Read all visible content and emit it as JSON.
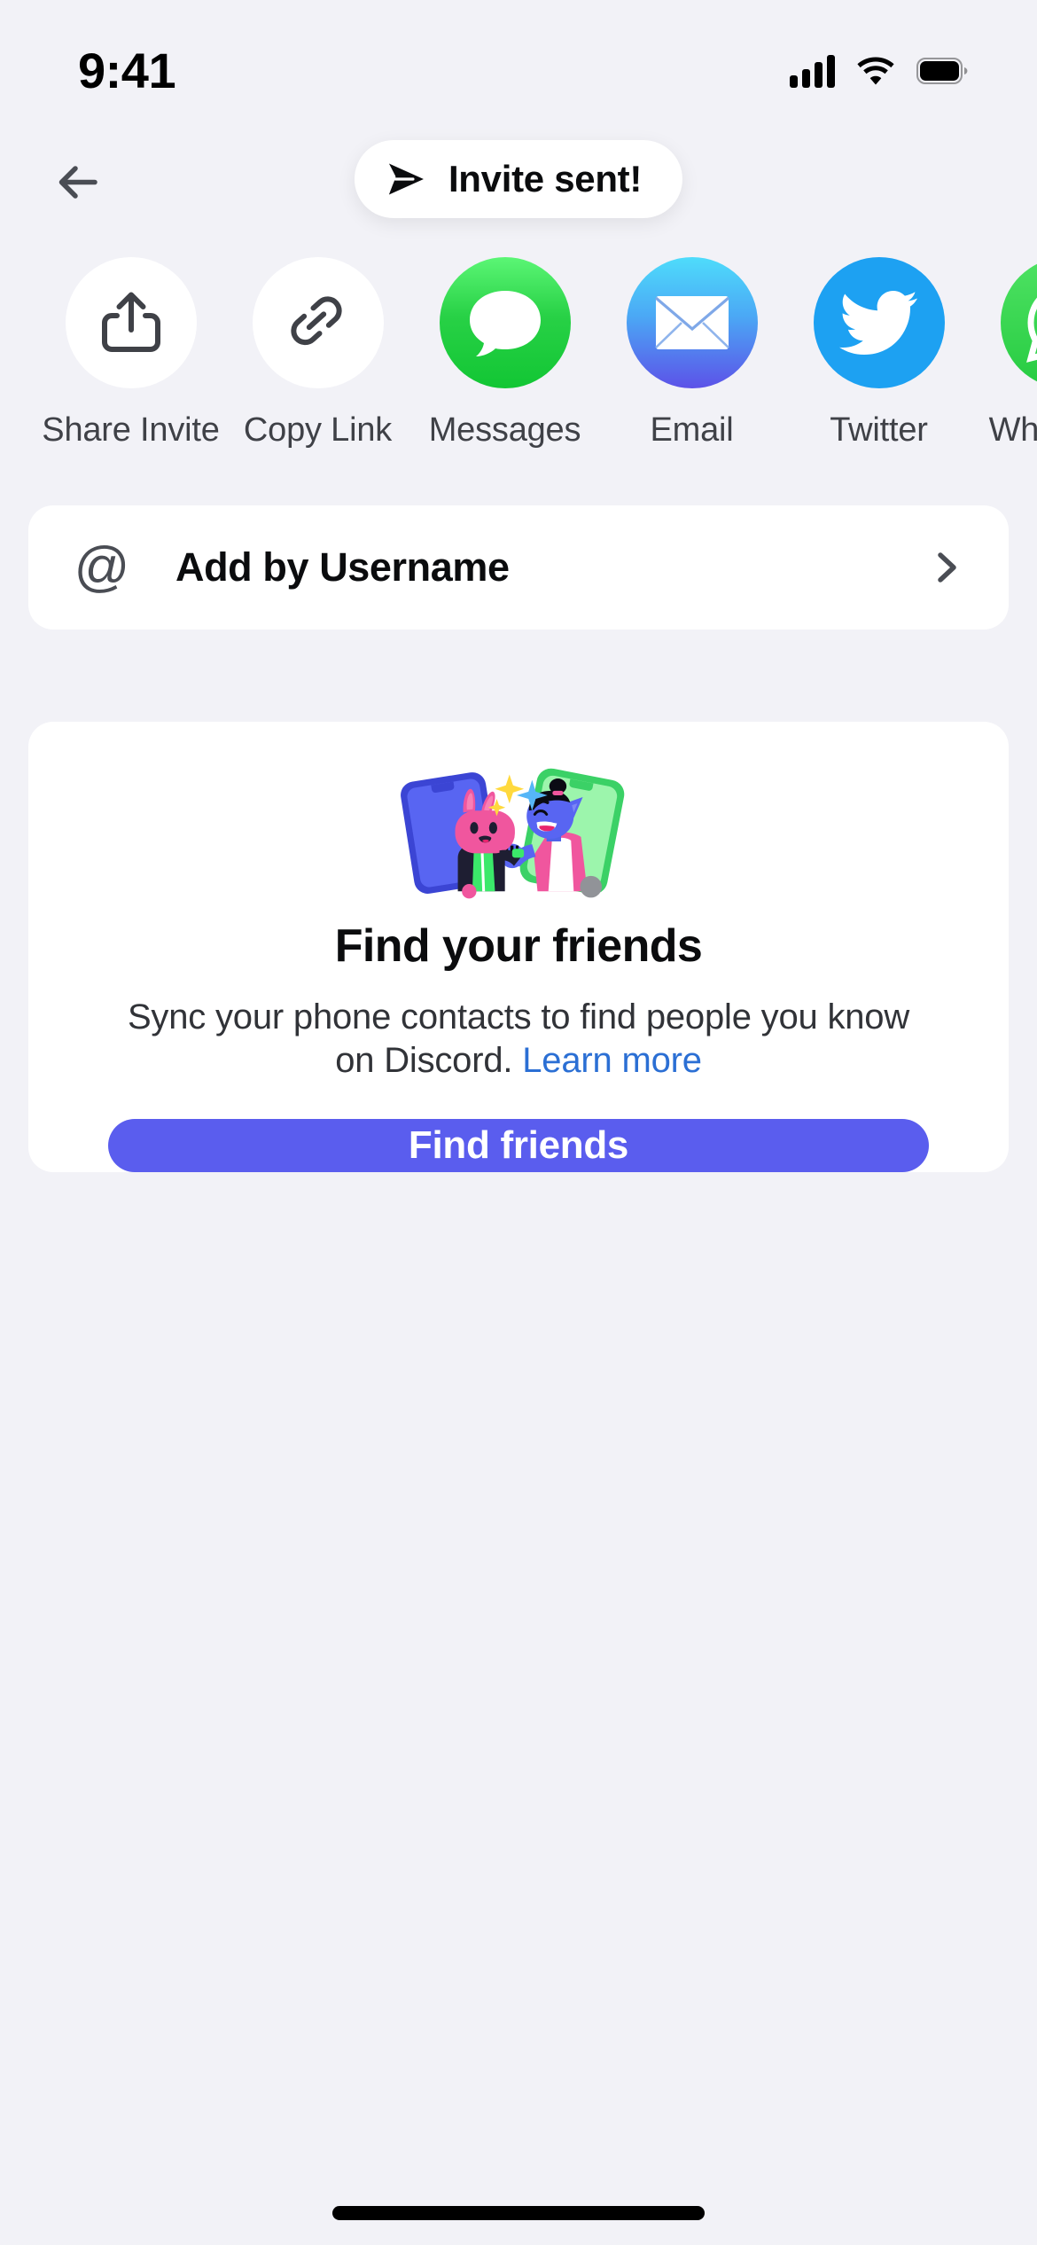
{
  "status_bar": {
    "time": "9:41",
    "signal_icon": "cellular-signal-icon",
    "wifi_icon": "wifi-icon",
    "battery_icon": "battery-full-icon"
  },
  "nav": {
    "back_icon": "arrow-left-icon"
  },
  "toast": {
    "icon": "send-icon",
    "message": "Invite sent!"
  },
  "share_row": {
    "items": [
      {
        "label": "Share Invite",
        "icon": "share-upload-icon",
        "style": "plain"
      },
      {
        "label": "Copy Link",
        "icon": "link-chain-icon",
        "style": "plain"
      },
      {
        "label": "Messages",
        "icon": "speech-bubble-icon",
        "style": "messages"
      },
      {
        "label": "Email",
        "icon": "envelope-icon",
        "style": "email"
      },
      {
        "label": "Twitter",
        "icon": "twitter-bird-icon",
        "style": "twitter"
      },
      {
        "label": "WhatsApp",
        "icon": "whatsapp-icon",
        "style": "whatsapp"
      }
    ]
  },
  "add_by_username": {
    "at_symbol": "@",
    "label": "Add by Username",
    "chevron_icon": "chevron-right-icon"
  },
  "find_friends_card": {
    "illustration": "two-characters-fist-bump-phones-illustration",
    "title": "Find your friends",
    "description_before_link": "Sync your phone contacts to find people you know on Discord. ",
    "link_text": "Learn more",
    "button_label": "Find friends"
  },
  "colors": {
    "background": "#F2F2F7",
    "card": "#FFFFFF",
    "blurple": "#5A5DEE",
    "link_blue": "#2B6FD4",
    "text_primary": "#0B0C0E",
    "text_secondary": "#3F4147",
    "messages_green": "#28D146",
    "email_blue": "#4BA8F5",
    "twitter_blue": "#1DA1F2",
    "whatsapp_green": "#26CB41"
  }
}
